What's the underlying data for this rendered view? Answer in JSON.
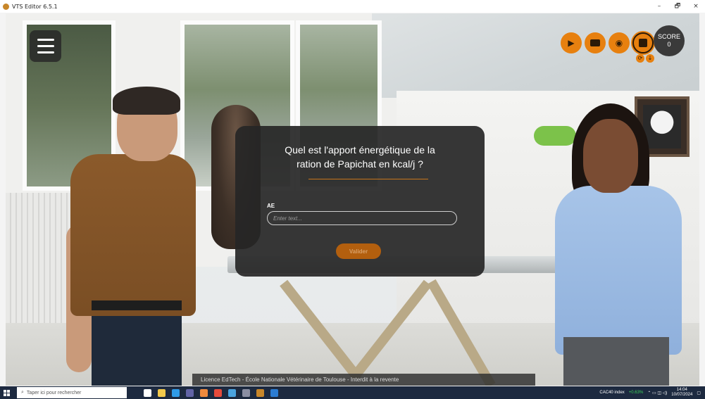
{
  "window": {
    "title": "VTS Editor 6.5.1",
    "controls": {
      "minimize": "–",
      "maximize": "🗗",
      "close": "×"
    }
  },
  "toolbar": {
    "menu_icon": "hamburger-icon",
    "buttons": [
      {
        "name": "video-camera",
        "icon": "video-camera-icon",
        "glyph": "▶"
      },
      {
        "name": "display",
        "icon": "monitor-icon",
        "glyph": "▭"
      },
      {
        "name": "camera",
        "icon": "camera-icon",
        "glyph": "◉"
      },
      {
        "name": "stop",
        "icon": "stop-icon",
        "glyph": "■",
        "active": true
      }
    ],
    "mini_buttons": [
      {
        "name": "rotate",
        "icon": "rotate-icon",
        "glyph": "⟳"
      },
      {
        "name": "down",
        "icon": "arrow-down-icon",
        "glyph": "↓"
      }
    ],
    "accent_color": "#e7800f"
  },
  "score": {
    "label": "SCORE",
    "value": "0"
  },
  "dialog": {
    "question_line1": "Quel est l'apport énergétique de la",
    "question_line2": "ration de Papichat en kcal/j ?",
    "field_label": "AE",
    "field_value": "",
    "field_placeholder": "Enter text...",
    "submit_label": "Valider"
  },
  "licence": "Licence EdTech - École Nationale Vétérinaire de Toulouse - Interdit à la revente",
  "taskbar": {
    "search_placeholder": "Taper ici pour rechercher",
    "search_icon": "search-icon",
    "stock_label": "CAC40 index",
    "stock_change": "+0.63%",
    "time": "14:04",
    "date": "10/07/2024",
    "pinned_icons": [
      {
        "name": "task-view-icon",
        "color": "#ffffff"
      },
      {
        "name": "file-explorer-icon",
        "color": "#f2c94c"
      },
      {
        "name": "edge-icon",
        "color": "#2f9be8"
      },
      {
        "name": "teams-icon",
        "color": "#6264a7"
      },
      {
        "name": "paint-icon",
        "color": "#f08a3e"
      },
      {
        "name": "chrome-icon",
        "color": "#e64a3b"
      },
      {
        "name": "app-icon",
        "color": "#4aa3df"
      },
      {
        "name": "tool-icon",
        "color": "#8b8fa3"
      },
      {
        "name": "vts-icon",
        "color": "#c8872a"
      },
      {
        "name": "word-icon",
        "color": "#2b7cd3"
      }
    ]
  }
}
